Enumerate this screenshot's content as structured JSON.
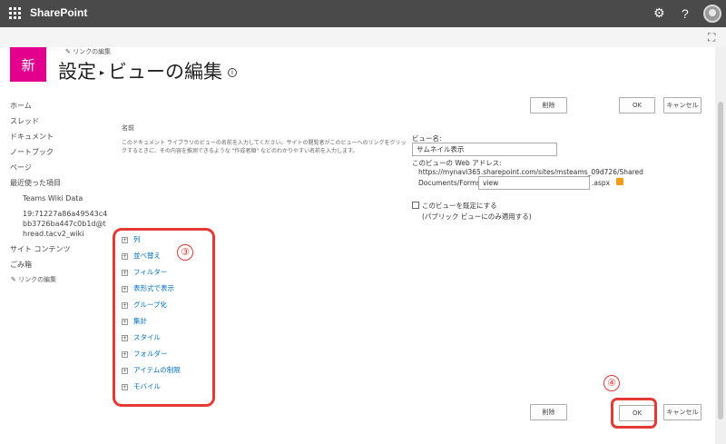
{
  "suite": {
    "brand": "SharePoint",
    "gear_icon": "gear-icon",
    "help_symbol": "?"
  },
  "header": {
    "site_logo_text": "新",
    "edit_links": "リンクの編集",
    "title_part1": "設定",
    "title_sep": "▸",
    "title_part2": "ビューの編集",
    "info_symbol": "i"
  },
  "leftnav": {
    "items": [
      "ホーム",
      "スレッド",
      "ドキュメント",
      "ノートブック",
      "ページ",
      "最近使った項目",
      "Teams Wiki Data",
      "19:71227a86a49543c4bb3726ba447c0b1d@thread.tacv2_wiki",
      "サイト コンテンツ",
      "ごみ箱"
    ],
    "edit_links": "リンクの編集"
  },
  "buttons": {
    "delete": "削除",
    "ok": "OK",
    "cancel": "キャンセル"
  },
  "name_section": {
    "label": "名前",
    "description": "このドキュメント ライブラリのビューの名前を入力してください。サイトの閲覧者がこのビューへのリンクをクリックするときに、その内容を推測できるような \"作成者順\" などのわかりやすい名前を入力します。",
    "view_name_label": "ビュー名:",
    "view_name_value": "サムネイル表示",
    "web_address_label": "このビューの Web アドレス:",
    "url_line1": "https://mynavi365.sharepoint.com/sites/msteams_09d726/Shared",
    "url_prefix": "Documents/Forms/",
    "url_value": "view",
    "url_suffix": ".aspx",
    "default_view_label": "このビューを既定にする",
    "default_view_note": "(パブリック ビューにのみ適用する)"
  },
  "sections": [
    "列",
    "並べ替え",
    "フィルター",
    "表形式で表示",
    "グループ化",
    "集計",
    "スタイル",
    "フォルダー",
    "アイテムの制限",
    "モバイル"
  ],
  "annotations": {
    "step3": "③",
    "step4": "④"
  },
  "colors": {
    "suitebar": "#4a4a4a",
    "site_logo": "#e3008c",
    "link": "#0072c6",
    "highlight": "#e53935"
  }
}
